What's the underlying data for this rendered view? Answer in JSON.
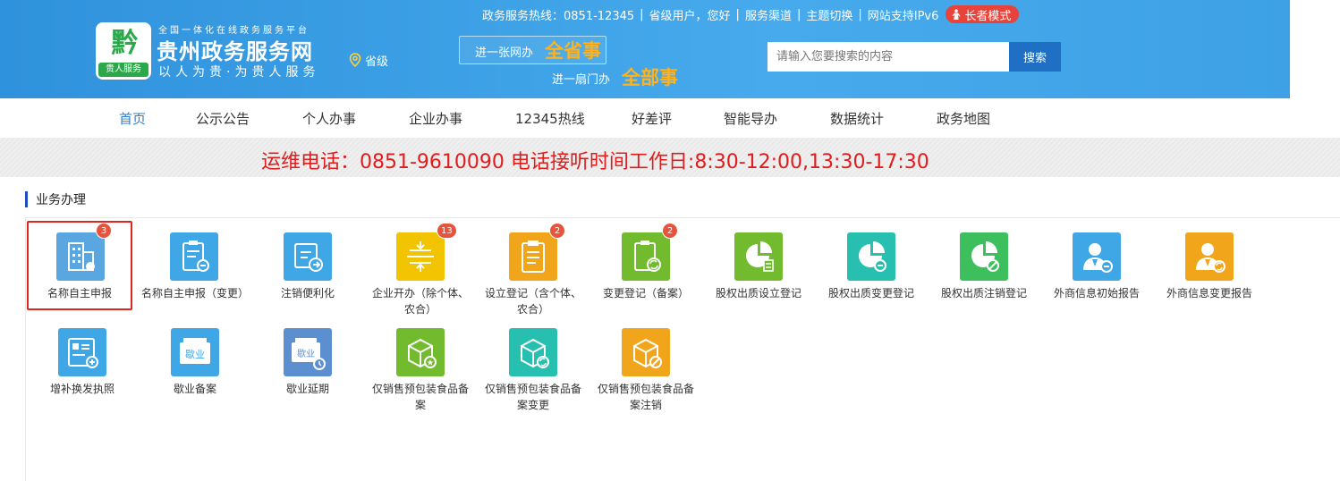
{
  "header": {
    "logo_mark": "黔",
    "logo_tag": "贵人服务",
    "site_subtitle": "全国一体化在线政务服务平台",
    "site_title": "贵州政务服务网",
    "site_slogan": "以人为贵·为贵人服务",
    "location": "省级",
    "banner": {
      "line1": "进一张网办",
      "line1_emph": "全省事",
      "line2": "进一扇门办",
      "line2_emph": "全部事"
    },
    "topbar": {
      "hotline": "政务服务热线：0851-12345",
      "user": "省级用户，您好",
      "channel": "服务渠道",
      "theme": "主题切换",
      "ipv6": "网站支持IPv6",
      "elder_mode": "长者模式"
    },
    "search": {
      "placeholder": "请输入您要搜索的内容",
      "button": "搜索"
    }
  },
  "nav": {
    "items": [
      {
        "label": "首页",
        "active": true
      },
      {
        "label": "公示公告"
      },
      {
        "label": "个人办事"
      },
      {
        "label": "企业办事"
      },
      {
        "label": "12345热线"
      },
      {
        "label": "好差评"
      },
      {
        "label": "智能导办"
      },
      {
        "label": "数据统计"
      },
      {
        "label": "政务地图"
      }
    ]
  },
  "notice": {
    "text": "运维电话：0851-9610090 电话接听时间工作日:8:30-12:00,13:30-17:30"
  },
  "section": {
    "title": "业务办理",
    "tiles": [
      {
        "label": "名称自主申报",
        "badge": "3",
        "color": "#5aa6e0",
        "icon": "building-icon",
        "selected": true
      },
      {
        "label": "名称自主申报（变更）",
        "color": "#3fa7e6",
        "icon": "clipboard-minus-icon"
      },
      {
        "label": "注销便利化",
        "color": "#3fa7e6",
        "icon": "exit-icon"
      },
      {
        "label": "企业开办（除个体、农合）",
        "badge": "13",
        "color": "#f2c400",
        "icon": "split-icon"
      },
      {
        "label": "设立登记（含个体、农合）",
        "badge": "2",
        "color": "#f1a51b",
        "icon": "clipboard-icon"
      },
      {
        "label": "变更登记（备案）",
        "badge": "2",
        "color": "#72bb2f",
        "icon": "clipboard-refresh-icon"
      },
      {
        "label": "股权出质设立登记",
        "color": "#72bb2f",
        "icon": "pie-chart-icon"
      },
      {
        "label": "股权出质变更登记",
        "color": "#27c0b0",
        "icon": "pie-chart-minus-icon"
      },
      {
        "label": "股权出质注销登记",
        "color": "#3cbf5c",
        "icon": "pie-chart-cancel-icon"
      },
      {
        "label": "外商信息初始报告",
        "color": "#3fa7e6",
        "icon": "person-minus-icon"
      },
      {
        "label": "外商信息变更报告",
        "color": "#f1a51b",
        "icon": "person-refresh-icon"
      },
      {
        "label": "增补换发执照",
        "color": "#3fa7e6",
        "icon": "license-add-icon"
      },
      {
        "label": "歇业备案",
        "color": "#3fa7e6",
        "icon": "suspend-icon",
        "icon_text": "歇业"
      },
      {
        "label": "歇业延期",
        "color": "#5b8fcf",
        "icon": "suspend-extend-icon",
        "icon_text": "歇业"
      },
      {
        "label": "仅销售预包装食品备案",
        "color": "#72bb2f",
        "icon": "box-star-icon"
      },
      {
        "label": "仅销售预包装食品备案变更",
        "color": "#27c0b0",
        "icon": "box-refresh-icon"
      },
      {
        "label": "仅销售预包装食品备案注销",
        "color": "#f1a51b",
        "icon": "box-cancel-icon"
      }
    ]
  }
}
